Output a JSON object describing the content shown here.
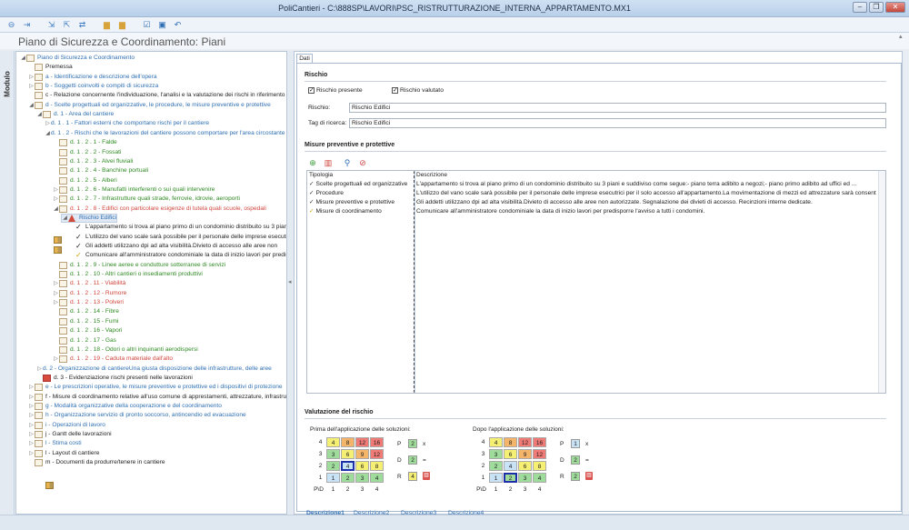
{
  "window": {
    "title": "PoliCantieri - C:\\888SP\\LAVORI\\PSC_RISTRUTTURAZIONE_INTERNA_APPARTAMENTO.MX1"
  },
  "header": {
    "title": "Piano di Sicurezza e Coordinamento: Piani"
  },
  "side_label": "Modulo",
  "tree": [
    {
      "text": "Piano di Sicurezza e Coordinamento",
      "color": "blue",
      "indent": 0,
      "icon": "doc",
      "arrow": "◢"
    },
    {
      "text": "Premessa",
      "color": "black",
      "indent": 1,
      "icon": "doc",
      "arrow": ""
    },
    {
      "text": "a  - Identificazione e descrizione dell'opera",
      "color": "blue",
      "indent": 1,
      "icon": "doc",
      "arrow": "▷"
    },
    {
      "text": "b  - Soggetti coinvolti e compiti di sicurezza",
      "color": "blue",
      "indent": 1,
      "icon": "doc",
      "arrow": "▷"
    },
    {
      "text": "c  - Relazione concernente l'individuazione, l'analisi e la valutazione dei rischi in riferimento all'area ed all'organizzazione del cantiere",
      "color": "black",
      "indent": 1,
      "icon": "doc",
      "arrow": ""
    },
    {
      "text": "d  - Scelte progettuali ed organizzative, le procedure, le misure preventive e protettive",
      "color": "blue",
      "indent": 1,
      "icon": "doc",
      "arrow": "◢"
    },
    {
      "text": "d.  1  - Area del cantiere",
      "color": "blue",
      "indent": 2,
      "icon": "doc",
      "arrow": "◢"
    },
    {
      "text": "d.  1 .  1  - Fattori esterni che comportano rischi per il cantiere",
      "color": "blue",
      "indent": 3,
      "icon": "grid",
      "arrow": "▷"
    },
    {
      "text": "d.  1 .  2  - Rischi che le lavorazioni del cantiere possono comportare per l'area circostante",
      "color": "blue",
      "indent": 3,
      "icon": "grid",
      "arrow": "◢"
    },
    {
      "text": "d.  1 .  2 .  1  - Falde",
      "color": "green",
      "indent": 4,
      "icon": "doc",
      "arrow": ""
    },
    {
      "text": "d.  1 .  2 .  2  - Fossati",
      "color": "green",
      "indent": 4,
      "icon": "doc",
      "arrow": ""
    },
    {
      "text": "d.  1 .  2 .  3  - Alvei fluviali",
      "color": "green",
      "indent": 4,
      "icon": "doc",
      "arrow": ""
    },
    {
      "text": "d.  1 .  2 .  4  - Banchine portuali",
      "color": "green",
      "indent": 4,
      "icon": "doc",
      "arrow": ""
    },
    {
      "text": "d.  1 .  2 .  5  - Alberi",
      "color": "green",
      "indent": 4,
      "icon": "doc",
      "arrow": ""
    },
    {
      "text": "d.  1 .  2 .  6  - Manufatti interferenti o sui quali intervenire",
      "color": "green",
      "indent": 4,
      "icon": "doc",
      "arrow": "▷"
    },
    {
      "text": "d.  1 .  2 .  7  - Infrastrutture quali strade, ferrovie, idrovie, aeroporti",
      "color": "green",
      "indent": 4,
      "icon": "doc",
      "arrow": "▷"
    },
    {
      "text": "d.  1 .  2 .  8  - Edifici con particolare esigenze di tutela quali scuole, ospedali",
      "color": "red",
      "indent": 4,
      "icon": "doc",
      "arrow": "◢"
    },
    {
      "text": "Rischio Edifici",
      "color": "blue",
      "indent": 5,
      "icon": "warn",
      "arrow": "◢",
      "selected": true
    },
    {
      "text": "L'appartamento si trova al piano primo di un condominio distribuito su 3 piani",
      "color": "black",
      "indent": 6,
      "icon": "check",
      "arrow": ""
    },
    {
      "text": "L'utilizzo del vano scale sarà possibile per il personale delle imprese esecutrici",
      "color": "black",
      "indent": 6,
      "icon": "check",
      "arrow": ""
    },
    {
      "text": "Gli addetti utilizzano dpi ad alta visibilità.Divieto di accesso alle aree non",
      "color": "black",
      "indent": 6,
      "icon": "check",
      "arrow": ""
    },
    {
      "text": "Comunicare all'amministratore condominiale la data di inizio lavori per predisporre",
      "color": "black",
      "indent": 6,
      "icon": "checky",
      "arrow": ""
    },
    {
      "text": "d.  1 .  2 .  9  - Linee aeree e condutture sotterranee di servizi",
      "color": "green",
      "indent": 4,
      "icon": "doc",
      "arrow": ""
    },
    {
      "text": "d.  1 .  2 .  10  - Altri cantieri o insediamenti produttivi",
      "color": "green",
      "indent": 4,
      "icon": "doc",
      "arrow": ""
    },
    {
      "text": "d.  1 .  2 .  11  - Viabilità",
      "color": "red",
      "indent": 4,
      "icon": "doc",
      "arrow": "▷"
    },
    {
      "text": "d.  1 .  2 .  12  - Rumore",
      "color": "red",
      "indent": 4,
      "icon": "doc",
      "arrow": "▷"
    },
    {
      "text": "d.  1 .  2 .  13  - Polveri",
      "color": "red",
      "indent": 4,
      "icon": "doc",
      "arrow": "▷"
    },
    {
      "text": "d.  1 .  2 .  14  - Fibre",
      "color": "green",
      "indent": 4,
      "icon": "doc",
      "arrow": ""
    },
    {
      "text": "d.  1 .  2 .  15  - Fumi",
      "color": "green",
      "indent": 4,
      "icon": "doc",
      "arrow": ""
    },
    {
      "text": "d.  1 .  2 .  16  - Vapori",
      "color": "green",
      "indent": 4,
      "icon": "doc",
      "arrow": ""
    },
    {
      "text": "d.  1 .  2 .  17  - Gas",
      "color": "green",
      "indent": 4,
      "icon": "doc",
      "arrow": ""
    },
    {
      "text": "d.  1 .  2 .  18  - Odori o altri inquinanti aerodispersi",
      "color": "green",
      "indent": 4,
      "icon": "doc",
      "arrow": ""
    },
    {
      "text": "d.  1 .  2 .  19  - Caduta materiale dall'alto",
      "color": "red",
      "indent": 4,
      "icon": "doc",
      "arrow": "▷"
    },
    {
      "text": "d.  2  - Organizzazione di cantiereUna giusta disposizione delle infrastrutture, delle aree",
      "color": "blue",
      "indent": 2,
      "icon": "grid",
      "arrow": "▷"
    },
    {
      "text": "d.  3  - Evidenziazione rischi presenti nelle lavorazioni",
      "color": "black",
      "indent": 2,
      "icon": "red",
      "arrow": ""
    },
    {
      "text": "e  - Le prescrizioni operative, le misure preventive e protettive ed i dispositivi di protezione",
      "color": "blue",
      "indent": 1,
      "icon": "doc",
      "arrow": "▷"
    },
    {
      "text": "f  - Misure di coordinamento relative all'uso comune di apprestamenti, attrezzature, infrastrutture",
      "color": "black",
      "indent": 1,
      "icon": "doc",
      "arrow": "▷"
    },
    {
      "text": "g  - Modalità organizzative della cooperazione e del coordinamento",
      "color": "blue",
      "indent": 1,
      "icon": "doc",
      "arrow": "▷"
    },
    {
      "text": "h  - Organizzazione servizio di pronto soccorso, antincendio ed evacuazione",
      "color": "blue",
      "indent": 1,
      "icon": "doc",
      "arrow": "▷"
    },
    {
      "text": "i  - Operazioni di lavoro",
      "color": "blue",
      "indent": 1,
      "icon": "doc",
      "arrow": "▷"
    },
    {
      "text": "j  - Gantt delle lavorazioni",
      "color": "black",
      "indent": 1,
      "icon": "doc",
      "arrow": "▷"
    },
    {
      "text": "l  - Stima costi",
      "color": "blue",
      "indent": 1,
      "icon": "doc",
      "arrow": "▷"
    },
    {
      "text": "l  - Layout di cantiere",
      "color": "black",
      "indent": 1,
      "icon": "doc",
      "arrow": "▷"
    },
    {
      "text": "m  - Documenti da produrre/tenere in cantiere",
      "color": "black",
      "indent": 1,
      "icon": "doc",
      "arrow": ""
    }
  ],
  "tab": {
    "label": "Dati"
  },
  "rischio": {
    "section": "Rischio",
    "presente_label": "Rischio presente",
    "presente": true,
    "valutato_label": "Rischio valutato",
    "valutato": true,
    "rischio_label": "Rischio:",
    "rischio_value": "Rischio Edifici",
    "tag_label": "Tag di ricerca:",
    "tag_value": "Rischio Edifici"
  },
  "misure": {
    "section": "Misure preventive e protettive",
    "col_tipologia": "Tipologia",
    "col_descrizione": "Descrizione",
    "rows": [
      {
        "tipologia": "Scelte progettuali ed organizzative",
        "descrizione": "L'appartamento si trova al piano primo di un condominio distribuito su 3 piani e suddiviso come segue:- piano terra adibito a negozi;- piano primo adibito ad uffici ed ...",
        "mark": "check"
      },
      {
        "tipologia": "Procedure",
        "descrizione": "L'utilizzo del vano scale sarà possibile per il personale delle imprese esecutrici per il solo accesso all'appartamento.La movimentazione di mezzi ed attrezzature sarà consentit...",
        "mark": "check"
      },
      {
        "tipologia": "Misure preventive e protettive",
        "descrizione": "Gli addetti utilizzano dpi ad alta visibilità.Divieto di accesso alle aree non autorizzate. Segnalazione dei divieti di accesso. Recinzioni interne dedicate.",
        "mark": "check"
      },
      {
        "tipologia": "Misure di coordinamento",
        "descrizione": "Comunicare all'amministratore condominiale la data di inizio lavori per predisporre l'avviso a tutti i condomini.",
        "mark": "checky"
      }
    ]
  },
  "valutazione": {
    "section": "Valutazione del rischio",
    "prima": {
      "title": "Prima dell'applicazione delle soluzioni:",
      "P": "2",
      "D": "2",
      "R": "4",
      "highlight": [
        2,
        2
      ]
    },
    "dopo": {
      "title": "Dopo l'applicazione delle soluzioni:",
      "P": "1",
      "D": "2",
      "R": "2",
      "highlight": [
        1,
        2
      ]
    },
    "matrix": [
      [
        "4",
        "8",
        "12",
        "16"
      ],
      [
        "3",
        "6",
        "9",
        "12"
      ],
      [
        "2",
        "4",
        "6",
        "8"
      ],
      [
        "1",
        "2",
        "3",
        "4"
      ]
    ],
    "row_labels": [
      "4",
      "3",
      "2",
      "1"
    ],
    "col_labels": [
      "P\\D",
      "1",
      "2",
      "3",
      "4"
    ],
    "labels": {
      "P": "P",
      "D": "D",
      "R": "R",
      "x": "x",
      "eq": "="
    }
  },
  "bottom_tabs": [
    "Descrizione1",
    "Descrizione2",
    "Descrizione3",
    "Descrizione4"
  ],
  "colors": {
    "blue": "#2e6fb3",
    "green": "#2f8a23",
    "red": "#d0463c",
    "black": "#222222"
  }
}
